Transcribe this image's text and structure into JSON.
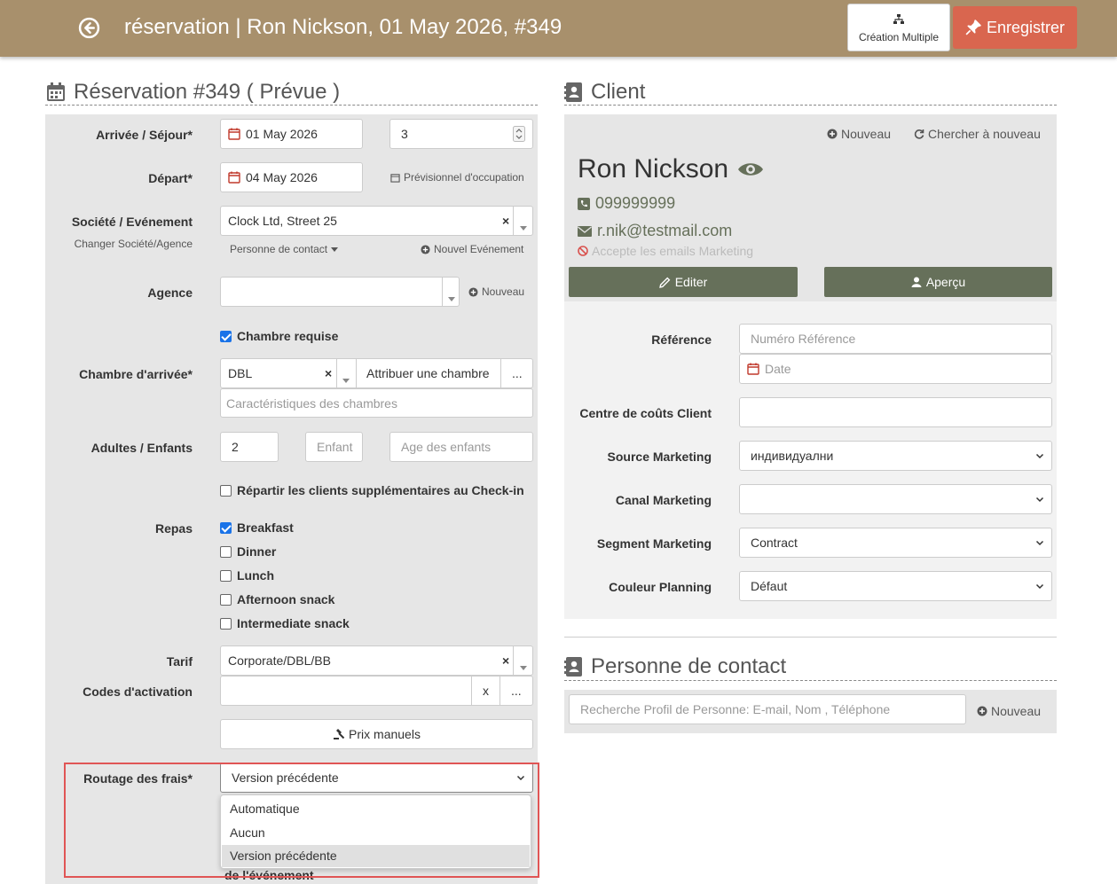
{
  "header": {
    "title": "réservation | Ron Nickson, 01 May 2026, #349",
    "multi_label": "Création Multiple",
    "save_label": "Enregistrer"
  },
  "reservation": {
    "title": "Réservation #349 ( Prévue )",
    "arrival_label": "Arrivée / Séjour*",
    "arrival_date": "01 May 2026",
    "nights": "3",
    "departure_label": "Départ*",
    "departure_date": "04 May 2026",
    "occupancy_link": "Prévisionnel d'occupation",
    "company_label": "Société / Evénement",
    "change_company_link": "Changer Société/Agence",
    "company_value": "Clock Ltd, Street 25",
    "contact_person_link": "Personne de contact",
    "new_event_link": "Nouvel Evénement",
    "agency_label": "Agence",
    "agency_new": "Nouveau",
    "room_required": "Chambre requise",
    "arrival_room_label": "Chambre d'arrivée*",
    "room_type": "DBL",
    "assign_room": "Attribuer une chambre",
    "more": "...",
    "room_features_placeholder": "Caractéristiques des chambres",
    "adults_label": "Adultes / Enfants",
    "adults": "2",
    "children_placeholder": "Enfant",
    "children_age_placeholder": "Age des enfants",
    "split_guests": "Répartir les clients supplémentaires au Check-in",
    "meals_label": "Repas",
    "meals": [
      {
        "label": "Breakfast",
        "checked": true
      },
      {
        "label": "Dinner",
        "checked": false
      },
      {
        "label": "Lunch",
        "checked": false
      },
      {
        "label": "Afternoon snack",
        "checked": false
      },
      {
        "label": "Intermediate snack",
        "checked": false
      }
    ],
    "rate_label": "Tarif",
    "rate_value": "Corporate/DBL/BB",
    "codes_label": "Codes d'activation",
    "codes_clear": "x",
    "manual_prices": "Prix manuels",
    "routing_label": "Routage des frais*",
    "routing_value": "Version précédente",
    "routing_options": [
      "Automatique",
      "Aucun",
      "Version précédente"
    ],
    "hidden_text": "de l'événement"
  },
  "client": {
    "title": "Client",
    "new_link": "Nouveau",
    "search_again": "Chercher à nouveau",
    "name": "Ron Nickson",
    "phone": "099999999",
    "email": "r.nik@testmail.com",
    "marketing_emails": "Accepte les emails Marketing",
    "edit": "Editer",
    "preview": "Aperçu",
    "reference_label": "Référence",
    "reference_placeholder": "Numéro Référence",
    "date_placeholder": "Date",
    "cost_center_label": "Centre de coûts Client",
    "source_label": "Source Marketing",
    "source_value": "индивидуални",
    "channel_label": "Canal Marketing",
    "channel_value": "",
    "segment_label": "Segment Marketing",
    "segment_value": "Contract",
    "color_label": "Couleur Planning",
    "color_value": "Défaut"
  },
  "contact": {
    "title": "Personne de contact",
    "search_placeholder": "Recherche Profil de Personne: E-mail, Nom , Téléphone",
    "new_link": "Nouveau"
  }
}
